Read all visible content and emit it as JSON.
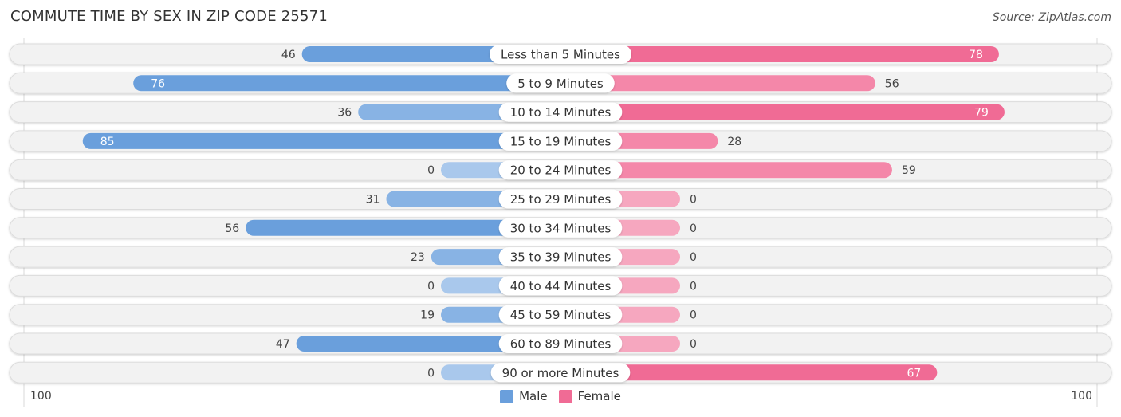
{
  "header": {
    "title": "COMMUTE TIME BY SEX IN ZIP CODE 25571",
    "source": "Source: ZipAtlas.com"
  },
  "colors": {
    "male": "#6a9fdc",
    "male_light": "#a9c8ec",
    "female": "#f06b95",
    "female_light": "#f6a7bf",
    "row_bg": "#f2f2f2",
    "row_border": "#dcdcdc"
  },
  "legend": {
    "male_label": "Male",
    "female_label": "Female"
  },
  "axis": {
    "left_label": "100",
    "right_label": "100"
  },
  "chart_data": {
    "type": "bar",
    "orientation": "horizontal-diverging",
    "title": "COMMUTE TIME BY SEX IN ZIP CODE 25571",
    "xlabel": "",
    "ylabel": "",
    "xlim": [
      -100,
      100
    ],
    "legend_position": "bottom-center",
    "grid": false,
    "categories": [
      "Less than 5 Minutes",
      "5 to 9 Minutes",
      "10 to 14 Minutes",
      "15 to 19 Minutes",
      "20 to 24 Minutes",
      "25 to 29 Minutes",
      "30 to 34 Minutes",
      "35 to 39 Minutes",
      "40 to 44 Minutes",
      "45 to 59 Minutes",
      "60 to 89 Minutes",
      "90 or more Minutes"
    ],
    "series": [
      {
        "name": "Male",
        "values": [
          46,
          76,
          36,
          85,
          0,
          31,
          56,
          23,
          0,
          19,
          47,
          0
        ]
      },
      {
        "name": "Female",
        "values": [
          78,
          56,
          79,
          28,
          59,
          0,
          0,
          0,
          0,
          0,
          0,
          67
        ]
      }
    ],
    "tick_labels": [
      "100",
      "100"
    ]
  }
}
